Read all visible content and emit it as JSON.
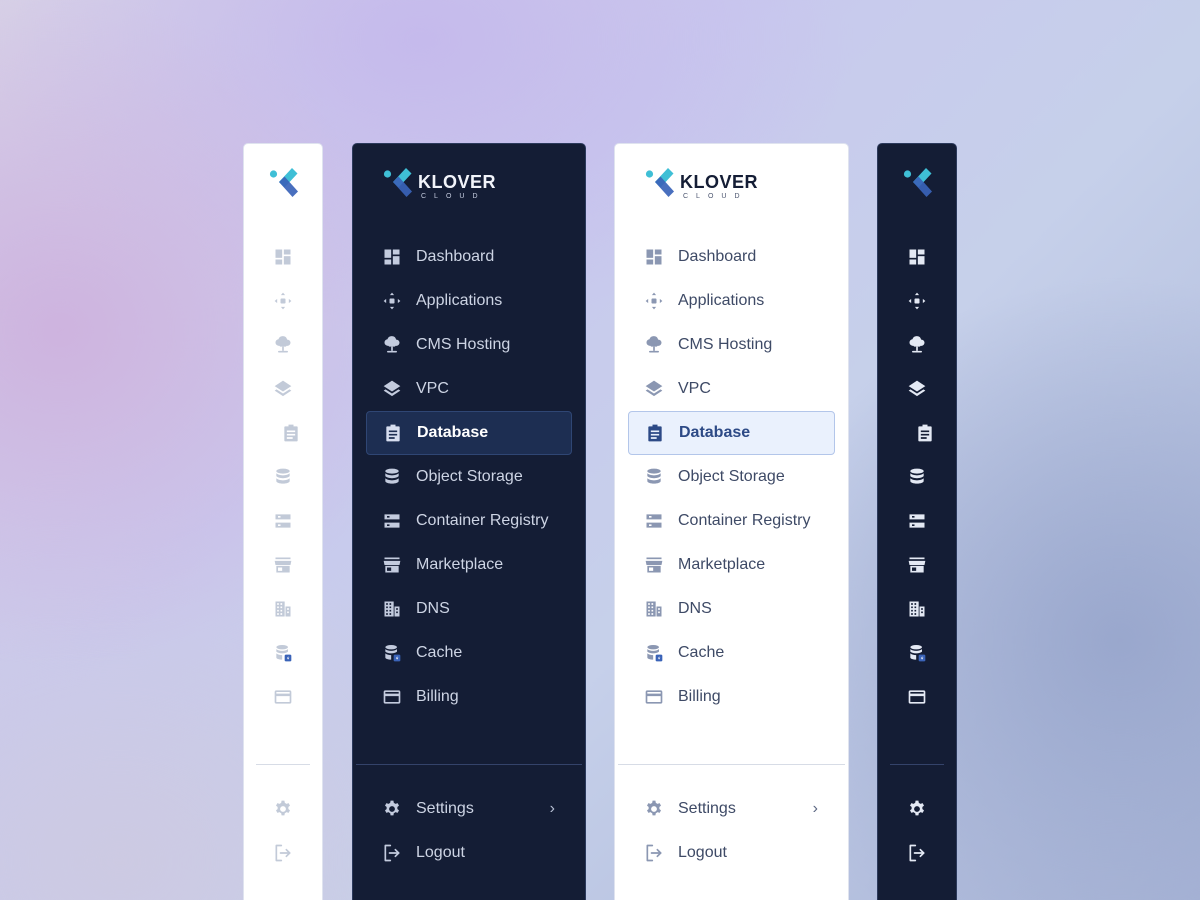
{
  "brand": {
    "name": "KLOVER",
    "sub": "CLOUD"
  },
  "menu": [
    {
      "label": "Dashboard",
      "icon": "dashboard-icon"
    },
    {
      "label": "Applications",
      "icon": "applications-icon"
    },
    {
      "label": "CMS Hosting",
      "icon": "cms-hosting-icon"
    },
    {
      "label": "VPC",
      "icon": "layers-icon"
    },
    {
      "label": "Database",
      "icon": "clipboard-icon",
      "active": true
    },
    {
      "label": "Object Storage",
      "icon": "database-stack-icon"
    },
    {
      "label": "Container Registry",
      "icon": "server-icon"
    },
    {
      "label": "Marketplace",
      "icon": "storefront-icon"
    },
    {
      "label": "DNS",
      "icon": "building-icon"
    },
    {
      "label": "Cache",
      "icon": "cache-icon"
    },
    {
      "label": "Billing",
      "icon": "credit-card-icon"
    }
  ],
  "bottom": [
    {
      "label": "Settings",
      "icon": "gear-icon",
      "has_submenu": true,
      "chevron": "›"
    },
    {
      "label": "Logout",
      "icon": "logout-icon"
    }
  ],
  "colors": {
    "dark_panel": "#141d35",
    "light_panel": "#ffffff",
    "active_dark": "#1d2e52",
    "active_light": "#eaf1fd",
    "logo_cyan": "#3fbfd6",
    "logo_blue": "#3a63b8"
  }
}
